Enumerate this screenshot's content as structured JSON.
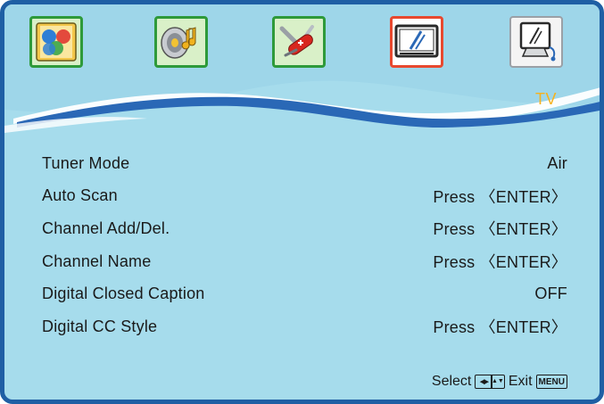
{
  "tabs": [
    {
      "icon": "picture-icon",
      "active": false
    },
    {
      "icon": "sound-icon",
      "active": false
    },
    {
      "icon": "setup-icon",
      "active": false
    },
    {
      "icon": "display-icon",
      "active": true
    },
    {
      "icon": "tv-icon",
      "active": false
    }
  ],
  "section_title": "TV",
  "menu": {
    "items": [
      {
        "label": "Tuner Mode",
        "value": "Air"
      },
      {
        "label": "Auto Scan",
        "value": "Press 〈ENTER〉"
      },
      {
        "label": "Channel Add/Del.",
        "value": "Press 〈ENTER〉"
      },
      {
        "label": "Channel Name",
        "value": "Press 〈ENTER〉"
      },
      {
        "label": "Digital Closed Caption",
        "value": "OFF"
      },
      {
        "label": "Digital CC Style",
        "value": "Press 〈ENTER〉"
      }
    ]
  },
  "footer": {
    "select_label": "Select",
    "exit_label": "Exit",
    "nav_key_left_right": "◀▶",
    "nav_key_up_down": "▲▼",
    "menu_key": "MENU"
  },
  "colors": {
    "background": "#a6dcec",
    "frame": "#1f5fa4",
    "accent_title": "#f6b21e",
    "active_tab_border": "#e8492f",
    "inactive_tab_border": "#2e9a3a"
  }
}
